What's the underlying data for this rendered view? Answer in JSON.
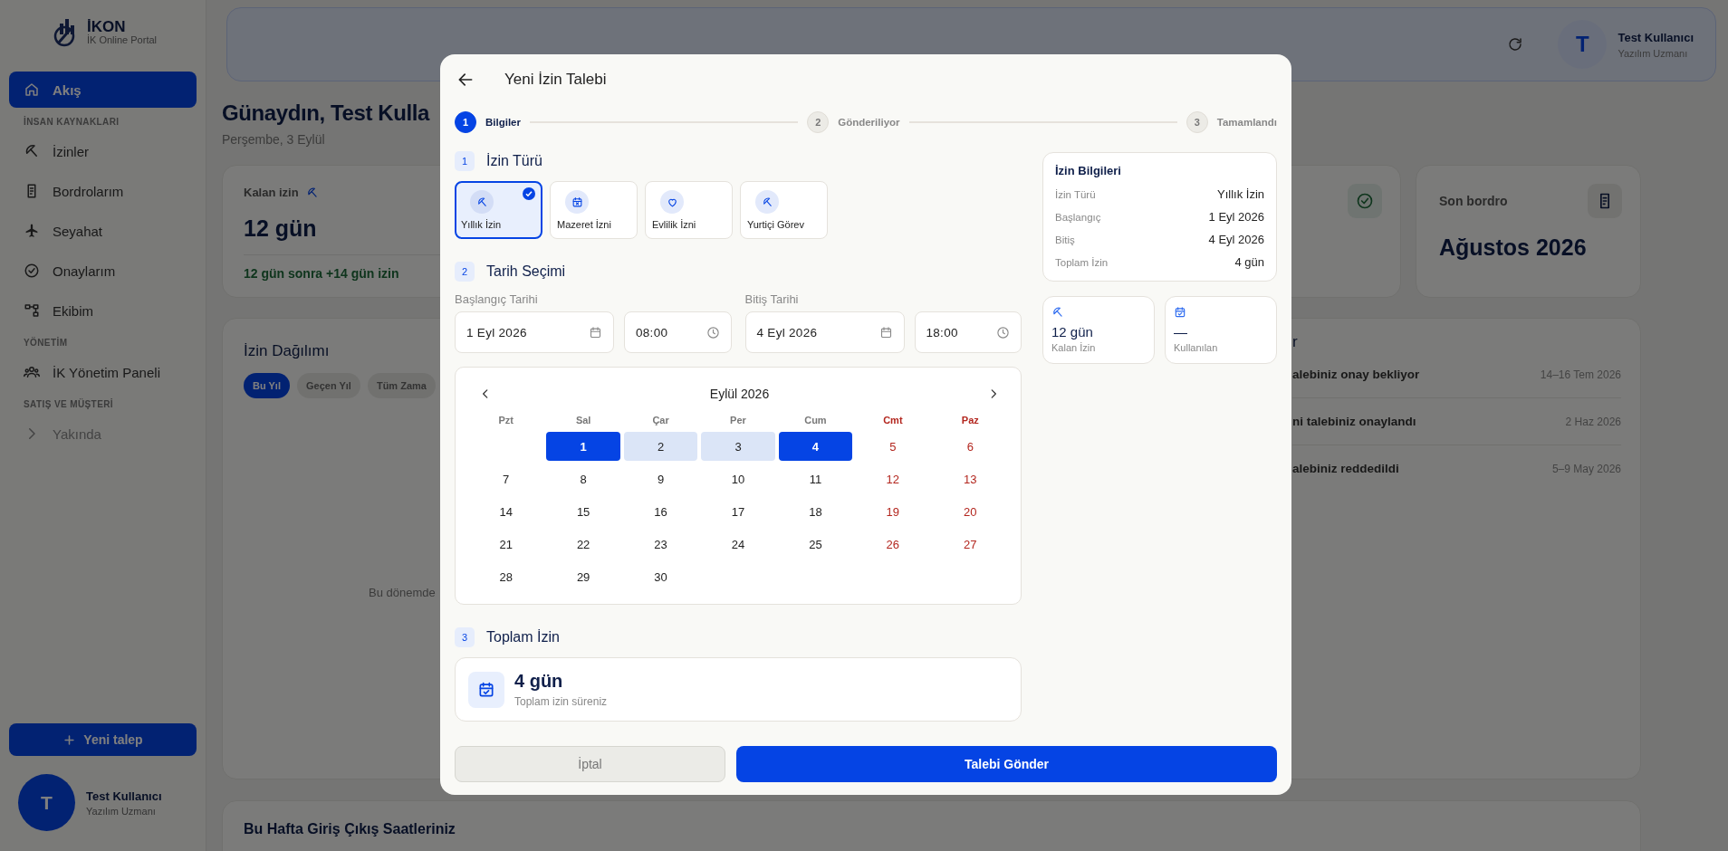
{
  "sidebar": {
    "brand": "İKON",
    "tagline": "İK Online Portal",
    "nav": [
      {
        "kind": "item",
        "label": "Akış",
        "selected": true,
        "disabled": false
      },
      {
        "kind": "section",
        "label": "İNSAN KAYNAKLARI"
      },
      {
        "kind": "item",
        "label": "İzinler",
        "selected": false,
        "disabled": false
      },
      {
        "kind": "item",
        "label": "Bordrolarım",
        "selected": false,
        "disabled": false
      },
      {
        "kind": "item",
        "label": "Seyahat",
        "selected": false,
        "disabled": false
      },
      {
        "kind": "item",
        "label": "Onaylarım",
        "selected": false,
        "disabled": false
      },
      {
        "kind": "item",
        "label": "Ekibim",
        "selected": false,
        "disabled": false
      },
      {
        "kind": "section",
        "label": "YÖNETİM"
      },
      {
        "kind": "item",
        "label": "İK Yönetim Paneli",
        "selected": false,
        "disabled": false
      },
      {
        "kind": "section",
        "label": "SATIŞ VE MÜŞTERİ"
      },
      {
        "kind": "item",
        "label": "Yakında",
        "selected": false,
        "disabled": true
      }
    ],
    "new_request": "Yeni talep",
    "user": {
      "initial": "T",
      "name": "Test Kullanıcı",
      "role": "Yazılım Uzmanı"
    }
  },
  "header": {
    "user": {
      "initial": "T",
      "name": "Test Kullanıcı",
      "role": "Yazılım Uzmanı"
    }
  },
  "greeting": {
    "title": "Günaydın, Test Kulla",
    "date": "Perşembe, 3 Eylül"
  },
  "stats": {
    "leave": {
      "label": "Kalan izin",
      "value": "12 gün",
      "note": "12 gün sonra +14 gün izin"
    },
    "payroll": {
      "label": "Son bordro",
      "value": "Ağustos 2026"
    }
  },
  "distribution": {
    "title": "İzin Dağılımı",
    "filters": [
      {
        "label": "Bu Yıl",
        "selected": true
      },
      {
        "label": "Geçen Yıl",
        "selected": false
      },
      {
        "label": "Tüm Zama",
        "selected": false
      }
    ],
    "empty_text": "Bu dönemde"
  },
  "requests": {
    "title": "r",
    "items": [
      {
        "text": "alebiniz onay bekliyor",
        "date": "14–16 Tem 2026"
      },
      {
        "text": "ni talebiniz onaylandı",
        "date": "2 Haz 2026"
      },
      {
        "text": "alebiniz reddedildi",
        "date": "5–9 May 2026"
      }
    ]
  },
  "weekly_hours": {
    "title": "Bu Hafta Giriş Çıkış Saatleriniz"
  },
  "modal": {
    "title": "Yeni İzin Talebi",
    "steps": [
      {
        "number": "1",
        "label": "Bilgiler",
        "selected": true
      },
      {
        "number": "2",
        "label": "Gönderiliyor",
        "selected": false
      },
      {
        "number": "3",
        "label": "Tamamlandı",
        "selected": false
      }
    ],
    "leave_type": {
      "number": "1",
      "title": "İzin Türü",
      "options": [
        {
          "label": "Yıllık İzin",
          "selected": true
        },
        {
          "label": "Mazeret İzni",
          "selected": false
        },
        {
          "label": "Evlilik İzni",
          "selected": false
        },
        {
          "label": "Yurtiçi Görev",
          "selected": false
        }
      ]
    },
    "dates": {
      "number": "2",
      "title": "Tarih Seçimi",
      "start": {
        "label": "Başlangıç Tarihi",
        "date": "1 Eyl 2026",
        "time": "08:00"
      },
      "end": {
        "label": "Bitiş Tarihi",
        "date": "4 Eyl 2026",
        "time": "18:00"
      },
      "calendar": {
        "month": "Eylül 2026",
        "weekdays": [
          {
            "label": "Pzt",
            "weekend": false
          },
          {
            "label": "Sal",
            "weekend": false
          },
          {
            "label": "Çar",
            "weekend": false
          },
          {
            "label": "Per",
            "weekend": false
          },
          {
            "label": "Cum",
            "weekend": false
          },
          {
            "label": "Cmt",
            "weekend": true
          },
          {
            "label": "Paz",
            "weekend": true
          }
        ],
        "weeks": [
          [
            {
              "label": "1",
              "selected": true,
              "in_range": false
            },
            {
              "label": "2",
              "selected": false,
              "in_range": true
            },
            {
              "label": "3",
              "selected": false,
              "in_range": true
            },
            {
              "label": "4",
              "selected": true,
              "in_range": false
            },
            {
              "label": "5",
              "selected": false,
              "in_range": false
            },
            {
              "label": "6",
              "selected": false,
              "in_range": false
            }
          ],
          [
            {
              "label": "7",
              "selected": false,
              "in_range": false
            },
            {
              "label": "8",
              "selected": false,
              "in_range": false
            },
            {
              "label": "9",
              "selected": false,
              "in_range": false
            },
            {
              "label": "10",
              "selected": false,
              "in_range": false
            },
            {
              "label": "11",
              "selected": false,
              "in_range": false
            },
            {
              "label": "12",
              "selected": false,
              "in_range": false
            },
            {
              "label": "13",
              "selected": false,
              "in_range": false
            }
          ],
          [
            {
              "label": "14",
              "selected": false,
              "in_range": false
            },
            {
              "label": "15",
              "selected": false,
              "in_range": false
            },
            {
              "label": "16",
              "selected": false,
              "in_range": false
            },
            {
              "label": "17",
              "selected": false,
              "in_range": false
            },
            {
              "label": "18",
              "selected": false,
              "in_range": false
            },
            {
              "label": "19",
              "selected": false,
              "in_range": false
            },
            {
              "label": "20",
              "selected": false,
              "in_range": false
            }
          ],
          [
            {
              "label": "21",
              "selected": false,
              "in_range": false
            },
            {
              "label": "22",
              "selected": false,
              "in_range": false
            },
            {
              "label": "23",
              "selected": false,
              "in_range": false
            },
            {
              "label": "24",
              "selected": false,
              "in_range": false
            },
            {
              "label": "25",
              "selected": false,
              "in_range": false
            },
            {
              "label": "26",
              "selected": false,
              "in_range": false
            },
            {
              "label": "27",
              "selected": false,
              "in_range": false
            }
          ],
          [
            {
              "label": "28",
              "selected": false,
              "in_range": false
            },
            {
              "label": "29",
              "selected": false,
              "in_range": false
            },
            {
              "label": "30",
              "selected": false,
              "in_range": false
            }
          ]
        ]
      }
    },
    "total": {
      "number": "3",
      "title": "Toplam İzin",
      "value": "4 gün",
      "caption": "Toplam izin süreniz"
    },
    "summary": {
      "title": "İzin Bilgileri",
      "rows": [
        {
          "label": "İzin Türü",
          "value": "Yıllık İzin"
        },
        {
          "label": "Başlangıç",
          "value": "1 Eyl 2026"
        },
        {
          "label": "Bitiş",
          "value": "4 Eyl 2026"
        },
        {
          "label": "Toplam İzin",
          "value": "4 gün"
        }
      ]
    },
    "tiles": [
      {
        "value": "12 gün",
        "label": "Kalan İzin"
      },
      {
        "value": "—",
        "label": "Kullanılan"
      }
    ],
    "cancel": "İptal",
    "submit": "Talebi Gönder"
  }
}
